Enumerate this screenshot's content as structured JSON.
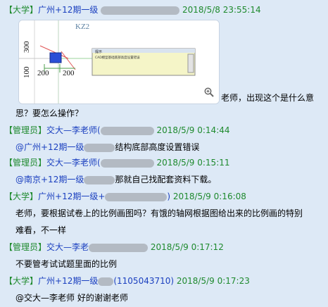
{
  "messages": [
    {
      "role": "【大学】",
      "name": "广州+12期一级",
      "time": "2018/5/8 23:55:14",
      "image": {
        "label_kz": "KZ2",
        "label_300": "300",
        "label_100": "100",
        "label_200a": "200",
        "label_200b": "200",
        "dialog_title": "提示",
        "dialog_text": "CAD模型基础底部高度设置错误"
      },
      "text_part1": "老师，出现这个是什么意",
      "text_part2": "思？要怎么操作？"
    },
    {
      "role": "【管理员】",
      "name": "交大—李老师(",
      "time": "2018/5/9 0:14:44",
      "mention": "@广州+12期一级",
      "text": "结构底部高度设置错误"
    },
    {
      "role": "【管理员】",
      "name": "交大—李老师(",
      "time": "2018/5/9 0:15:11",
      "mention": "@南京+12期一级",
      "text": "那就自己找配套资料下载。"
    },
    {
      "role": "【大学】",
      "name": "广州+12期一级+",
      "close_paren": ")",
      "time": "2018/5/9 0:16:08",
      "text_part1": "老师，要根据试卷上的比例画图吗？有饿的轴网根据图给出来的比例画的特别",
      "text_part2": "难看，不一样"
    },
    {
      "role": "【管理员】",
      "name": "交大—李老",
      "time": "2018/5/9 0:17:12",
      "text": "不要管考试试题里面的比例"
    },
    {
      "role": "【大学】",
      "name": "广州+12期一级",
      "qq": "(1105043710)",
      "time": "2018/5/9 0:17:23",
      "text": "@交大—李老师 好的谢谢老师"
    }
  ],
  "colors": {
    "background": "#dde9f6",
    "header_green": "#1f8a2e",
    "name_blue": "#1a3fbf"
  },
  "icons": [
    "zoom-in-icon"
  ]
}
